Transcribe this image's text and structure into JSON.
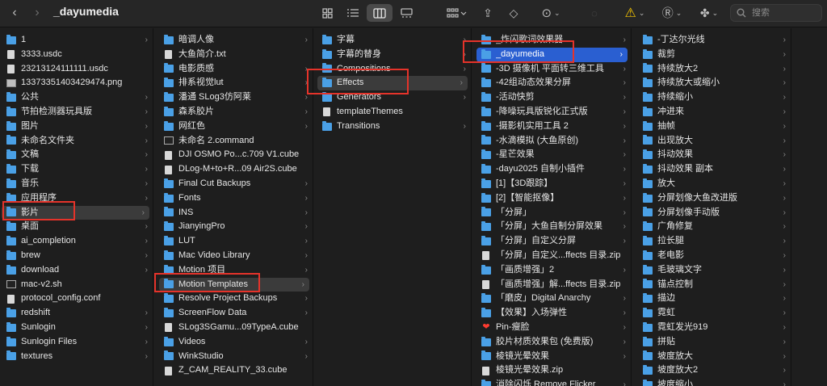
{
  "window": {
    "title": "_dayumedia"
  },
  "toolbar": {
    "back_label": "‹",
    "forward_label": "›",
    "share_label": "⇪",
    "tag_label": "◇",
    "more_label": "⊙",
    "warn_label": "⚠",
    "r_label": "Ⓡ",
    "clover_label": "✤",
    "search_placeholder": "搜索"
  },
  "columns": [
    {
      "items": [
        {
          "label": "1",
          "kind": "folder",
          "chev": true
        },
        {
          "label": "3333.usdc",
          "kind": "file"
        },
        {
          "label": "23213124111111.usdc",
          "kind": "file"
        },
        {
          "label": "13373351403429474.png",
          "kind": "img"
        },
        {
          "label": "公共",
          "kind": "folder",
          "chev": true
        },
        {
          "label": "节拍检测器玩具版",
          "kind": "folder",
          "chev": true
        },
        {
          "label": "图片",
          "kind": "folder",
          "chev": true
        },
        {
          "label": "未命名文件夹",
          "kind": "folder",
          "chev": true
        },
        {
          "label": "文稿",
          "kind": "folder",
          "chev": true
        },
        {
          "label": "下载",
          "kind": "folder",
          "chev": true
        },
        {
          "label": "音乐",
          "kind": "folder",
          "chev": true
        },
        {
          "label": "应用程序",
          "kind": "folder",
          "chev": true
        },
        {
          "label": "影片",
          "kind": "folder",
          "chev": true,
          "sel": "gray"
        },
        {
          "label": "桌面",
          "kind": "folder",
          "chev": true
        },
        {
          "label": "ai_completion",
          "kind": "folder",
          "chev": true
        },
        {
          "label": "brew",
          "kind": "folder",
          "chev": true
        },
        {
          "label": "download",
          "kind": "folder",
          "chev": true
        },
        {
          "label": "mac-v2.sh",
          "kind": "term"
        },
        {
          "label": "protocol_config.conf",
          "kind": "file"
        },
        {
          "label": "redshift",
          "kind": "folder",
          "chev": true
        },
        {
          "label": "Sunlogin",
          "kind": "folder",
          "chev": true
        },
        {
          "label": "Sunlogin Files",
          "kind": "folder",
          "chev": true
        },
        {
          "label": "textures",
          "kind": "folder",
          "chev": true
        }
      ]
    },
    {
      "items": [
        {
          "label": "暗调人像",
          "kind": "folder",
          "chev": true
        },
        {
          "label": "大鱼简介.txt",
          "kind": "file"
        },
        {
          "label": "电影质感",
          "kind": "folder",
          "chev": true
        },
        {
          "label": "排系视觉lut",
          "kind": "folder",
          "chev": true
        },
        {
          "label": "潘通 SLog3仿阿莱",
          "kind": "folder",
          "chev": true
        },
        {
          "label": "森系胶片",
          "kind": "folder",
          "chev": true
        },
        {
          "label": "网红色",
          "kind": "folder",
          "chev": true
        },
        {
          "label": "未命名 2.command",
          "kind": "term"
        },
        {
          "label": "DJI OSMO Po...c.709 V1.cube",
          "kind": "file"
        },
        {
          "label": "DLog-M+to+R...09 Air2S.cube",
          "kind": "file"
        },
        {
          "label": "Final Cut Backups",
          "kind": "folder",
          "chev": true
        },
        {
          "label": "Fonts",
          "kind": "folder",
          "chev": true
        },
        {
          "label": "INS",
          "kind": "folder",
          "chev": true
        },
        {
          "label": "JianyingPro",
          "kind": "folder",
          "chev": true
        },
        {
          "label": "LUT",
          "kind": "folder",
          "chev": true
        },
        {
          "label": "Mac Video Library",
          "kind": "folder",
          "chev": true
        },
        {
          "label": "Motion 项目",
          "kind": "folder",
          "chev": true
        },
        {
          "label": "Motion Templates",
          "kind": "folder",
          "chev": true,
          "sel": "gray"
        },
        {
          "label": "Resolve Project Backups",
          "kind": "folder",
          "chev": true
        },
        {
          "label": "ScreenFlow Data",
          "kind": "folder",
          "chev": true
        },
        {
          "label": "SLog3SGamu...09TypeA.cube",
          "kind": "file"
        },
        {
          "label": "Videos",
          "kind": "folder",
          "chev": true
        },
        {
          "label": "WinkStudio",
          "kind": "folder",
          "chev": true
        },
        {
          "label": "Z_CAM_REALITY_33.cube",
          "kind": "file"
        }
      ]
    },
    {
      "items": [
        {
          "label": "字幕",
          "kind": "folder",
          "chev": true
        },
        {
          "label": "字幕的替身",
          "kind": "folder",
          "chev": true
        },
        {
          "label": "Compositions",
          "kind": "folder",
          "chev": true
        },
        {
          "label": "Effects",
          "kind": "folder",
          "chev": true,
          "sel": "gray"
        },
        {
          "label": "Generators",
          "kind": "folder",
          "chev": true
        },
        {
          "label": "templateThemes",
          "kind": "file"
        },
        {
          "label": "Transitions",
          "kind": "folder",
          "chev": true
        }
      ]
    },
    {
      "items": [
        {
          "label": "_炸闪歌词效果器",
          "kind": "folder",
          "chev": true
        },
        {
          "label": "_dayumedia",
          "kind": "folder",
          "chev": true,
          "sel": "blue"
        },
        {
          "label": "-3D 摄像机 平面转三维工具",
          "kind": "folder",
          "chev": true
        },
        {
          "label": "-42组动态效果分屏",
          "kind": "folder",
          "chev": true
        },
        {
          "label": "-活动快剪",
          "kind": "folder",
          "chev": true
        },
        {
          "label": "-降噪玩具版锐化正式版",
          "kind": "folder",
          "chev": true
        },
        {
          "label": "-摄影机实用工具 2",
          "kind": "folder",
          "chev": true
        },
        {
          "label": "-水滴模拟 (大鱼原创)",
          "kind": "folder",
          "chev": true
        },
        {
          "label": "-星芒效果",
          "kind": "folder",
          "chev": true
        },
        {
          "label": "-dayu2025 自制小插件",
          "kind": "folder",
          "chev": true
        },
        {
          "label": "[1]【3D跟踪】",
          "kind": "folder",
          "chev": true
        },
        {
          "label": "[2]【智能抠像】",
          "kind": "folder",
          "chev": true
        },
        {
          "label": "「分屏」",
          "kind": "folder",
          "chev": true
        },
        {
          "label": "「分屏」大鱼自制分屏效果",
          "kind": "folder",
          "chev": true
        },
        {
          "label": "「分屏」自定义分屏",
          "kind": "folder",
          "chev": true
        },
        {
          "label": "「分屏」自定义...ffects 目录.zip",
          "kind": "file"
        },
        {
          "label": "「画质增强」2",
          "kind": "folder",
          "chev": true
        },
        {
          "label": "「画质增强」解...ffects 目录.zip",
          "kind": "file"
        },
        {
          "label": "「磨皮」Digital Anarchy",
          "kind": "folder",
          "chev": true
        },
        {
          "label": "【效果】入场弹性",
          "kind": "folder",
          "chev": true
        },
        {
          "label": "Pin-瘦脸",
          "kind": "heart",
          "chev": true
        },
        {
          "label": "胶片材质效果包 (免费版)",
          "kind": "folder",
          "chev": true
        },
        {
          "label": "棱镜光晕效果",
          "kind": "folder",
          "chev": true
        },
        {
          "label": "棱镜光晕效果.zip",
          "kind": "file"
        },
        {
          "label": "消除闪烁 Remove Flicker",
          "kind": "folder",
          "chev": true
        }
      ]
    },
    {
      "items": [
        {
          "label": "-丁达尔光线",
          "kind": "folder",
          "chev": true
        },
        {
          "label": "裁剪",
          "kind": "folder",
          "chev": true
        },
        {
          "label": "持续放大2",
          "kind": "folder",
          "chev": true
        },
        {
          "label": "持续放大或缩小",
          "kind": "folder",
          "chev": true
        },
        {
          "label": "持续缩小",
          "kind": "folder",
          "chev": true
        },
        {
          "label": "冲进来",
          "kind": "folder",
          "chev": true
        },
        {
          "label": "抽帧",
          "kind": "folder",
          "chev": true
        },
        {
          "label": "出现放大",
          "kind": "folder",
          "chev": true
        },
        {
          "label": "抖动效果",
          "kind": "folder",
          "chev": true
        },
        {
          "label": "抖动效果 副本",
          "kind": "folder",
          "chev": true
        },
        {
          "label": "放大",
          "kind": "folder",
          "chev": true
        },
        {
          "label": "分屏划像大鱼改进版",
          "kind": "folder",
          "chev": true
        },
        {
          "label": "分屏划像手动版",
          "kind": "folder",
          "chev": true
        },
        {
          "label": "广角修复",
          "kind": "folder",
          "chev": true
        },
        {
          "label": "拉长腿",
          "kind": "folder",
          "chev": true
        },
        {
          "label": "老电影",
          "kind": "folder",
          "chev": true
        },
        {
          "label": "毛玻璃文字",
          "kind": "folder",
          "chev": true
        },
        {
          "label": "锚点控制",
          "kind": "folder",
          "chev": true
        },
        {
          "label": "描边",
          "kind": "folder",
          "chev": true
        },
        {
          "label": "霓虹",
          "kind": "folder",
          "chev": true
        },
        {
          "label": "霓虹发光919",
          "kind": "folder",
          "chev": true
        },
        {
          "label": "拼贴",
          "kind": "folder",
          "chev": true
        },
        {
          "label": "坡度放大",
          "kind": "folder",
          "chev": true
        },
        {
          "label": "坡度放大2",
          "kind": "folder",
          "chev": true
        },
        {
          "label": "坡度缩小",
          "kind": "folder",
          "chev": true
        }
      ]
    }
  ]
}
